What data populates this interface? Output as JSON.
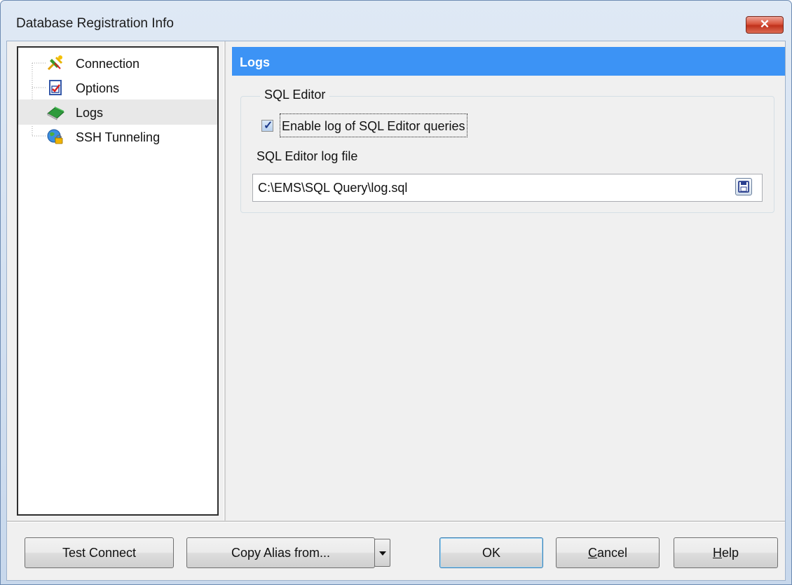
{
  "window": {
    "title": "Database Registration Info",
    "close_glyph": "✕"
  },
  "tree": {
    "items": [
      {
        "label": "Connection",
        "icon": "plug-icon"
      },
      {
        "label": "Options",
        "icon": "checklist-icon"
      },
      {
        "label": "Logs",
        "icon": "book-icon",
        "selected": true
      },
      {
        "label": "SSH Tunneling",
        "icon": "globe-lock-icon"
      }
    ]
  },
  "panel": {
    "header": "Logs",
    "group": {
      "title": "SQL Editor",
      "enable_log_label": "Enable log of SQL Editor queries",
      "enable_log_checked": true,
      "log_file_label": "SQL Editor log file",
      "log_file_value": "C:\\EMS\\SQL Query\\log.sql"
    }
  },
  "buttons": {
    "test_connect": "Test Connect",
    "copy_alias": "Copy Alias from...",
    "ok": "OK",
    "cancel": {
      "accel": "C",
      "rest": "ancel"
    },
    "help": {
      "accel": "H",
      "rest": "elp"
    }
  },
  "colors": {
    "header_bg": "#3c93f5",
    "header_text": "#ffffff",
    "close_btn": "#c8452c"
  }
}
